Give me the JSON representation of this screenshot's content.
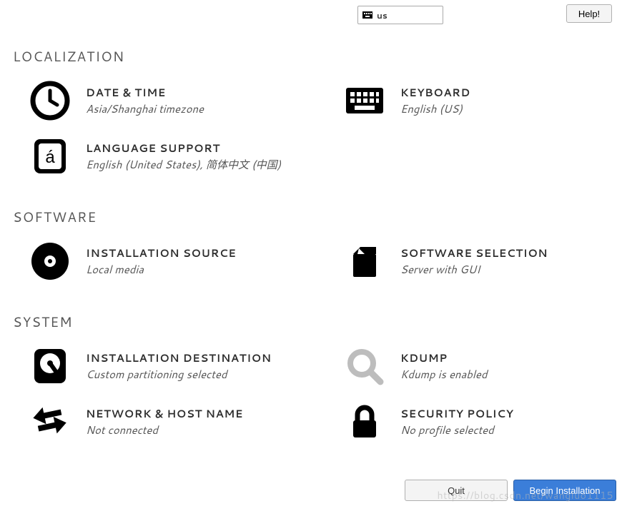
{
  "topbar": {
    "keyboard_layout": "us",
    "help_label": "Help!"
  },
  "sections": {
    "localization": {
      "heading": "LOCALIZATION",
      "date_time": {
        "title": "DATE & TIME",
        "status": "Asia/Shanghai timezone"
      },
      "keyboard": {
        "title": "KEYBOARD",
        "status": "English (US)"
      },
      "language": {
        "title": "LANGUAGE SUPPORT",
        "status": "English (United States), 简体中文 (中国)"
      }
    },
    "software": {
      "heading": "SOFTWARE",
      "installation_source": {
        "title": "INSTALLATION SOURCE",
        "status": "Local media"
      },
      "software_selection": {
        "title": "SOFTWARE SELECTION",
        "status": "Server with GUI"
      }
    },
    "system": {
      "heading": "SYSTEM",
      "installation_destination": {
        "title": "INSTALLATION DESTINATION",
        "status": "Custom partitioning selected"
      },
      "kdump": {
        "title": "KDUMP",
        "status": "Kdump is enabled"
      },
      "network": {
        "title": "NETWORK & HOST NAME",
        "status": "Not connected"
      },
      "security": {
        "title": "SECURITY POLICY",
        "status": "No profile selected"
      }
    }
  },
  "footer": {
    "quit_label": "Quit",
    "begin_label": "Begin Installation"
  },
  "watermark": "https://blog.csdn.net/wangluo1115"
}
